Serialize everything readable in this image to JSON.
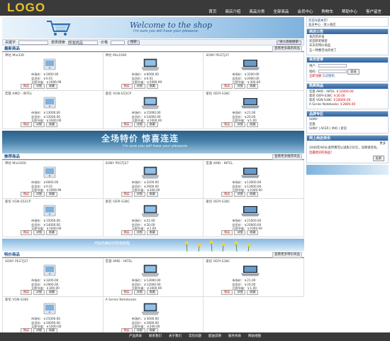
{
  "brand": {
    "logo": "LOGO"
  },
  "topnav": [
    "首页",
    "商店介绍",
    "商品分类",
    "全部商品",
    "会员中心",
    "购物车",
    "帮助中心",
    "客户留言"
  ],
  "banner": {
    "title": "Welcome to the shop",
    "subtitle": "I'm sure you will have your pleasure."
  },
  "search": {
    "label1": "关键字",
    "label2": "按类搜索",
    "category": "所有商品",
    "label3": "价格",
    "button": "搜索",
    "advanced": "进入高级搜索"
  },
  "sections": {
    "latest": {
      "title": "最新商品",
      "more": "查看更多最新商品"
    },
    "recommend": {
      "title": "推荐商品",
      "more": "查看更多推荐商品"
    },
    "special": {
      "title": "特价商品",
      "more": "查看更多特价商品"
    }
  },
  "price_labels": {
    "market": "市场价：",
    "member": "会员价：",
    "save": "立即节省："
  },
  "buttons": {
    "buy": "购买",
    "detail": "详细",
    "collect": "收藏"
  },
  "latest_products": [
    {
      "name": "神达 Mio339",
      "market": "￥2000.00",
      "member": "￥0.01",
      "save": "￥1999.99"
    },
    {
      "name": "神达 Mio1000",
      "market": "￥6000.00",
      "member": "￥0.01",
      "save": "￥5999.99"
    },
    {
      "name": "SONY PEGTJ37",
      "market": "￥3200.00",
      "member": "￥2900.00",
      "save": "￥300.00"
    },
    {
      "name": "宏基 AMD - INTEL",
      "market": "￥13000.00",
      "member": "￥12000.00",
      "save": "￥1000.00"
    },
    {
      "name": "索尼 VGN-S52CP",
      "market": "￥15000.00",
      "member": "￥14000.00",
      "save": "￥1000.00"
    },
    {
      "name": "索尼 OEPI-S38C",
      "market": "￥21.00",
      "member": "￥20.00",
      "save": "￥1.00"
    }
  ],
  "recommend_products": [
    {
      "name": "神达 Mio1000",
      "market": "￥6000.00",
      "member": "￥0.01",
      "save": "￥5999.99"
    },
    {
      "name": "SONY PEGTJ37",
      "market": "￥3200.00",
      "member": "￥2900.00",
      "save": "￥300.00"
    },
    {
      "name": "宏基 AMD - INTEL",
      "market": "￥13000.00",
      "member": "￥12000.00",
      "save": "￥1000.00"
    },
    {
      "name": "索尼 VGN-S52CP",
      "market": "￥15000.00",
      "member": "￥14000.00",
      "save": "￥1000.00"
    },
    {
      "name": "索尼 OEPI-S38C",
      "market": "￥21.00",
      "member": "￥20.00",
      "save": "￥1.00"
    },
    {
      "name": "索尼 OEPI-S38C",
      "market": "￥21000.00",
      "member": "￥20000.00",
      "save": "￥1000.00"
    }
  ],
  "special_products": [
    {
      "name": "SONY PEGTJ37",
      "market": "￥3200.00",
      "member": "￥2900.00",
      "save": "￥300.00"
    },
    {
      "name": "宏基 AMD - INTEL",
      "market": "￥13000.00",
      "member": "￥12000.00",
      "save": "￥1000.00"
    },
    {
      "name": "索尼 OEPI-S38C",
      "market": "￥21.00",
      "member": "￥20.00",
      "save": "￥1.00"
    },
    {
      "name": "索尼 VGN-S38C",
      "market": "￥21000.00",
      "member": "￥20000.00",
      "save": "￥1000.00"
    },
    {
      "name": "A Series Notebooks",
      "market": "￥3000.00",
      "member": "￥2800.00",
      "save": "￥200.00"
    }
  ],
  "promo": {
    "big": "全场特价 惊喜连连",
    "sub": "I'm sure you will have your pleasure."
  },
  "flower_banner": {
    "text": "开始你美好的购物旅程"
  },
  "right": {
    "user": {
      "line1": "欢迎光临本店！",
      "line2": "会员中心",
      "line3": "进入商店"
    },
    "notice": {
      "title": "商店公告",
      "items": [
        "本店新开张",
        "欢迎新老顾客",
        "天天有特价商品",
        "五一特惠活动开始了"
      ]
    },
    "login": {
      "title": "会员登录",
      "user_label": "用户：",
      "pass_label": "密码：",
      "login_btn": "登录",
      "register": "立即注册",
      "forgot": "忘记密码"
    },
    "hot": {
      "title": "热卖商品",
      "items": [
        {
          "name": "宏基 AMD - INTEL",
          "price": "￥12000.00"
        },
        {
          "name": "索尼 OEPI-S38C",
          "price": "￥20.00"
        },
        {
          "name": "索尼 VGN-S38C",
          "price": "￥20000.00"
        },
        {
          "name": "A Series Notebooks",
          "price": "￥2800.00"
        }
      ]
    },
    "brand": {
      "title": "品牌专区",
      "items": [
        "SONY",
        "宏基",
        "SONY | ACER | MIO | 索尼"
      ]
    },
    "news": {
      "title": "网上商店资讯",
      "more": "更多",
      "text": "2006年ADSL宽带费可以减免150元，详情请咨询。",
      "vote_title": "您最想买的商品？",
      "vote_btn": "投票"
    }
  },
  "footer": [
    "产品目录",
    "联系我们",
    "关于我们",
    "常见问题",
    "配送说明",
    "服务条款",
    "网站地图"
  ]
}
